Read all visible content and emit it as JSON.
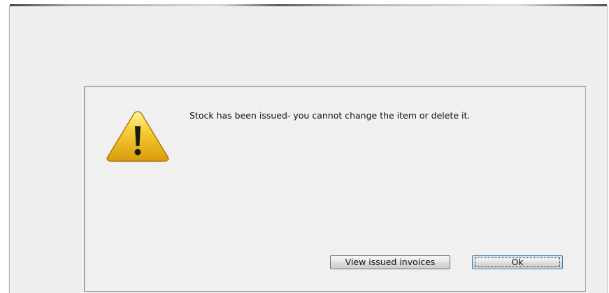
{
  "dialog": {
    "message": "Stock has been issued- you cannot change the item or delete it.",
    "icon": "warning-icon",
    "buttons": {
      "view_issued_invoices": "View issued invoices",
      "ok": "Ok"
    }
  },
  "colors": {
    "dialog_background": "#f0f0f0",
    "warning_yellow": "#f2c21b",
    "focus_border": "#3c7fb1"
  }
}
